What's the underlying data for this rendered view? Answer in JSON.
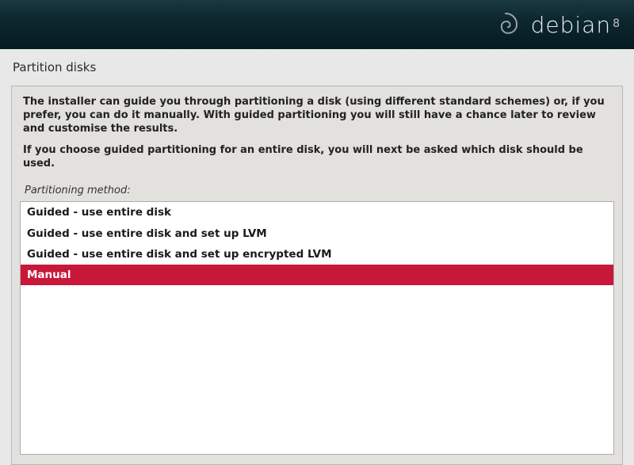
{
  "header": {
    "brand": "debian",
    "version": "8"
  },
  "page": {
    "title": "Partition disks"
  },
  "description": {
    "p1": "The installer can guide you through partitioning a disk (using different standard schemes) or, if you prefer, you can do it manually. With guided partitioning you will still have a chance later to review and customise the results.",
    "p2": "If you choose guided partitioning for an entire disk, you will next be asked which disk should be used."
  },
  "subheading": "Partitioning method:",
  "options": {
    "0": {
      "label": "Guided - use entire disk",
      "selected": false
    },
    "1": {
      "label": "Guided - use entire disk and set up LVM",
      "selected": false
    },
    "2": {
      "label": "Guided - use entire disk and set up encrypted LVM",
      "selected": false
    },
    "3": {
      "label": "Manual",
      "selected": true
    }
  }
}
